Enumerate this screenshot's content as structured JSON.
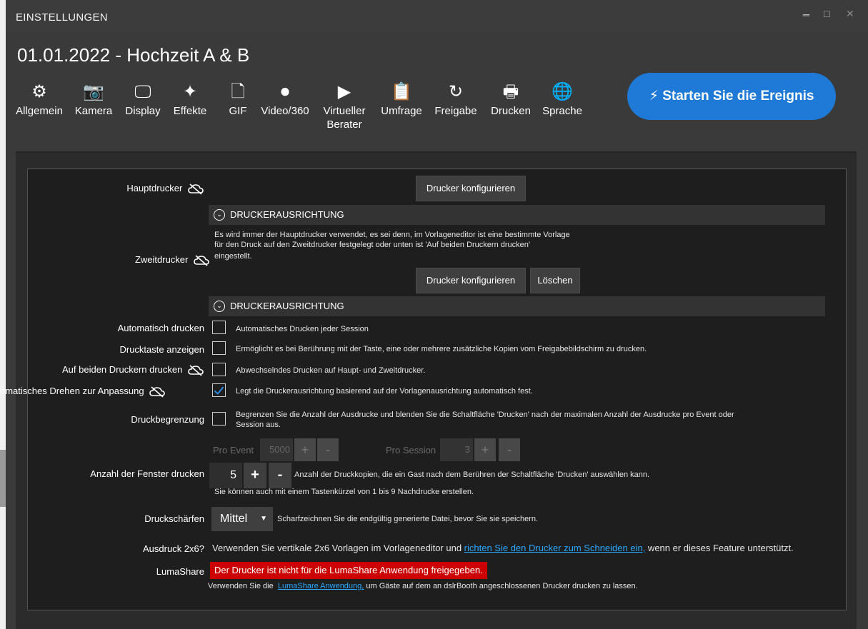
{
  "window": {
    "title": "EINSTELLUNGEN",
    "controls": {
      "minimize": "‗",
      "maximize": "□",
      "close": "✕"
    }
  },
  "event_title": "01.01.2022 - Hochzeit A & B",
  "nav": [
    {
      "label": "Allgemein",
      "icon": "gear-icon",
      "glyph": "⚙"
    },
    {
      "label": "Kamera",
      "icon": "camera-icon",
      "glyph": "📷"
    },
    {
      "label": "Display",
      "icon": "monitor-icon",
      "glyph": "🖵"
    },
    {
      "label": "Effekte",
      "icon": "effects-icon",
      "glyph": "✦"
    },
    {
      "label": "GIF",
      "icon": "gif-file-icon",
      "glyph": "🗋"
    },
    {
      "label": "Video/360",
      "icon": "video-icon",
      "glyph": "⏺"
    },
    {
      "label": "Virtueller",
      "label2": "Berater",
      "icon": "presentation-icon",
      "glyph": "▶"
    },
    {
      "label": "Umfrage",
      "icon": "clipboard-icon",
      "glyph": "📋"
    },
    {
      "label": "Freigabe",
      "icon": "share-icon",
      "glyph": "↻"
    },
    {
      "label": "Drucken",
      "icon": "printer-icon",
      "glyph": "🖶"
    },
    {
      "label": "Sprache",
      "icon": "globe-icon",
      "glyph": "🌐"
    }
  ],
  "start_button": {
    "icon": "lightning-icon",
    "glyph": "⚡",
    "label": "Starten Sie die Ereignis"
  },
  "settings": {
    "hauptdrucker": {
      "label": "Hauptdrucker",
      "button": "Drucker konfigurieren"
    },
    "section_ausrichtung": "DRUCKERAUSRICHTUNG",
    "zweitdrucker": {
      "label": "Zweitdrucker",
      "desc1": "Es wird immer der Hauptdrucker verwendet, es sei denn, im Vorlageneditor ist eine bestimmte Vorlage",
      "desc2": "für den Druck auf den Zweitdrucker festgelegt oder unten ist 'Auf beiden Druckern drucken'",
      "desc3": "eingestellt.",
      "button_config": "Drucker konfigurieren",
      "button_delete": "Löschen"
    },
    "automatisch": {
      "label": "Automatisch drucken",
      "desc": "Automatisches Drucken jeder Session",
      "checked": false
    },
    "drucktaste": {
      "label": "Drucktaste anzeigen",
      "desc": "Ermöglicht es bei Berührung mit der Taste, eine oder mehrere zusätzliche Kopien vom Freigabebildschirm zu drucken.",
      "checked": false
    },
    "beide": {
      "label": "Auf beiden Druckern drucken",
      "desc": "Abwechselndes Drucken auf Haupt- und Zweitdrucker.",
      "checked": false
    },
    "drehen": {
      "label": "omatisches Drehen zur Anpassung",
      "desc": "Legt die Druckerausrichtung basierend auf der Vorlagenausrichtung automatisch fest.",
      "checked": true
    },
    "begrenzung": {
      "label": "Druckbegrenzung",
      "desc1": "Begrenzen Sie die Anzahl der Ausdrucke und blenden Sie die Schaltfläche 'Drucken' nach der maximalen Anzahl der Ausdrucke pro Event oder",
      "desc2": "Session aus.",
      "checked": false,
      "pro_event_label": "Pro Event",
      "pro_event_value": "5000",
      "pro_session_label": "Pro Session",
      "pro_session_value": "3",
      "plus": "+",
      "minus": "-"
    },
    "fenster": {
      "label": "Anzahl der Fenster drucken",
      "value": "5",
      "plus": "+",
      "minus": "-",
      "desc": "Anzahl der Druckkopien, die ein Gast nach dem Berühren der Schaltfläche 'Drucken' auswählen kann.",
      "hint": "Sie können auch mit einem Tastenkürzel von 1 bis 9 Nachdrucke erstellen."
    },
    "schaerfen": {
      "label": "Druckschärfen",
      "value": "Mittel",
      "desc": "Scharfzeichnen Sie die endgültig generierte Datei, bevor Sie sie speichern."
    },
    "ausdruck": {
      "label": "Ausdruck 2x6?",
      "pre": "Verwenden Sie vertikale 2x6 Vorlagen im Vorlageneditor und ",
      "link": "richten Sie den Drucker zum Schneiden ein,",
      "post": " wenn er dieses Feature unterstützt."
    },
    "lumashare": {
      "label": "LumaShare",
      "error": "Der Drucker ist nicht für die LumaShare Anwendung freigegeben.",
      "pre": "Verwenden Sie die  ",
      "link": "LumaShare Anwendung,",
      "post": " um Gäste auf dem an dslrBooth angeschlossenen Drucker drucken zu lassen."
    }
  },
  "colors": {
    "accent": "#1e7ad6",
    "link": "#29a8ff",
    "error": "#cc0000",
    "check": "#2d8ee8"
  }
}
